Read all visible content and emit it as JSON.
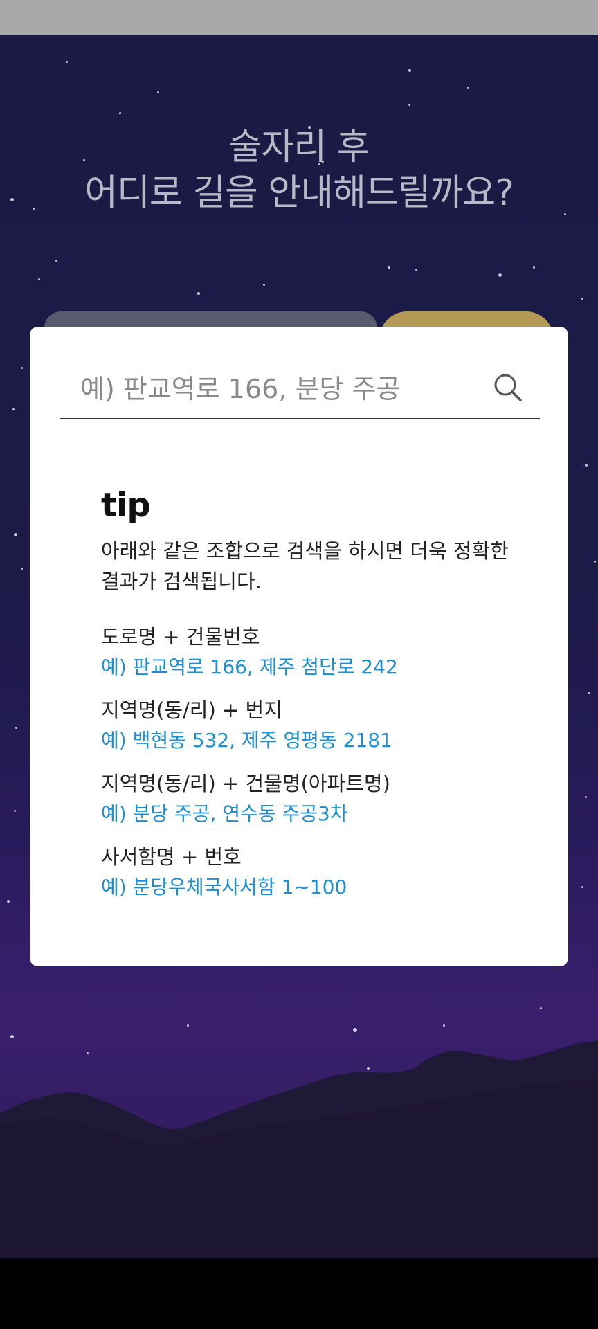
{
  "headline": {
    "line1": "술자리 후",
    "line2": "어디로 길을 안내해드릴까요?"
  },
  "search": {
    "placeholder": "예) 판교역로 166, 분당 주공",
    "value": "",
    "icon": "search-icon"
  },
  "tip": {
    "title": "tip",
    "description": "아래와 같은 조합으로 검색을 하시면 더욱 정확한 결과가 검색됩니다.",
    "items": [
      {
        "label": "도로명 + 건물번호",
        "example": "예) 판교역로 166,  제주 첨단로 242"
      },
      {
        "label": "지역명(동/리) + 번지",
        "example": "예) 백현동 532,  제주 영평동 2181"
      },
      {
        "label": "지역명(동/리) + 건물명(아파트명)",
        "example": "예) 분당 주공,  연수동 주공3차"
      },
      {
        "label": "사서함명 + 번호",
        "example": "예) 분당우체국사서함 1~100"
      }
    ]
  },
  "colors": {
    "sky_top": "#1b1a44",
    "sky_bottom": "#3a1f6e",
    "tab_left": "#5a5a6c",
    "tab_right": "#b59a55",
    "example_text": "#1a8fd6"
  }
}
